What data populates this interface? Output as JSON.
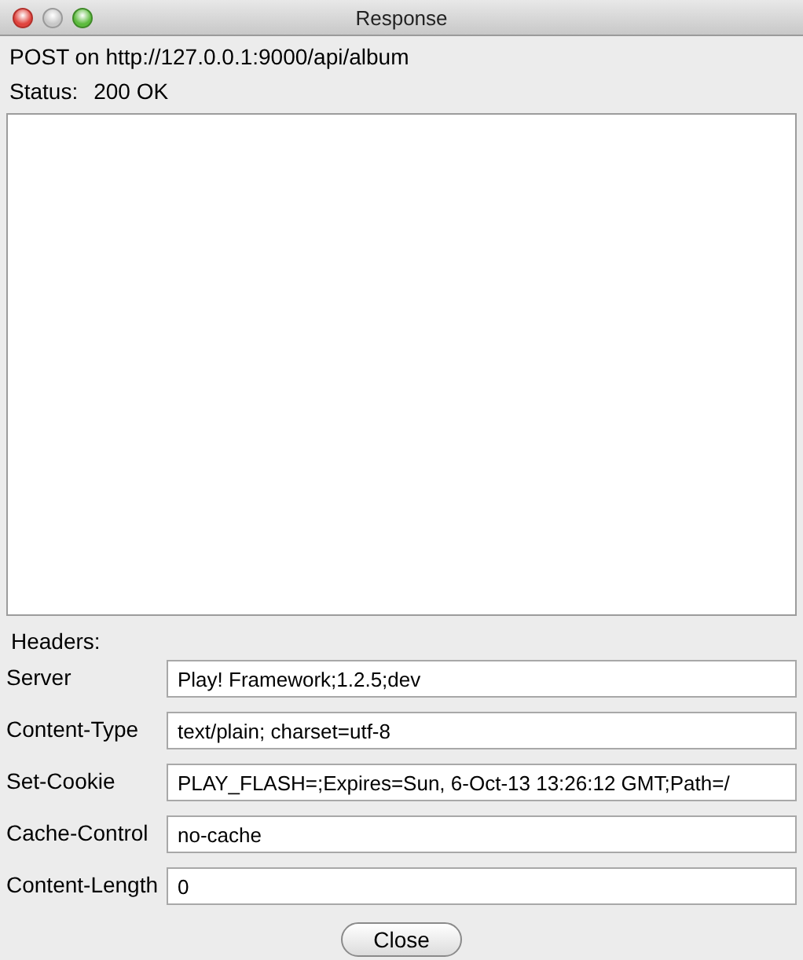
{
  "window": {
    "title": "Response"
  },
  "request_line": "POST on http://127.0.0.1:9000/api/album",
  "status": {
    "label": "Status:",
    "value": "200 OK"
  },
  "headers_label": "Headers:",
  "headers": [
    {
      "name": "Server",
      "value": "Play! Framework;1.2.5;dev"
    },
    {
      "name": "Content-Type",
      "value": "text/plain; charset=utf-8"
    },
    {
      "name": "Set-Cookie",
      "value": "PLAY_FLASH=;Expires=Sun, 6-Oct-13 13:26:12 GMT;Path=/"
    },
    {
      "name": "Cache-Control",
      "value": "no-cache"
    },
    {
      "name": "Content-Length",
      "value": "0"
    }
  ],
  "buttons": [
    {
      "label": "Close"
    }
  ]
}
